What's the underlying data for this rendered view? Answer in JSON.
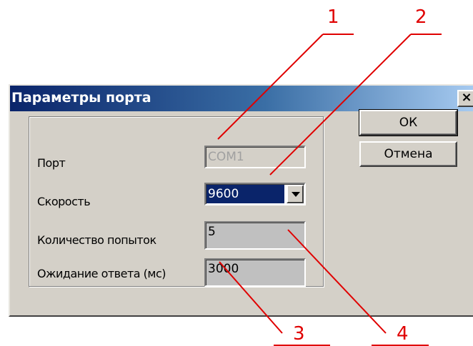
{
  "dialog": {
    "title": "Параметры порта",
    "close_label": "×"
  },
  "fields": {
    "port_label": "Порт",
    "port_value": "COM1",
    "speed_label": "Скорость",
    "speed_value": "9600",
    "retries_label": "Количество попыток",
    "retries_value": "5",
    "timeout_label": "Ожидание ответа (мс)",
    "timeout_value": "3000"
  },
  "buttons": {
    "ok_label": "ОК",
    "cancel_label": "Отмена"
  },
  "callouts": {
    "c1": "1",
    "c2": "2",
    "c3": "3",
    "c4": "4",
    "color": "#e00000"
  },
  "colors": {
    "title_start": "#0a246a",
    "title_end": "#a6caf0",
    "face": "#d4d0c8",
    "selection": "#0a246a"
  }
}
